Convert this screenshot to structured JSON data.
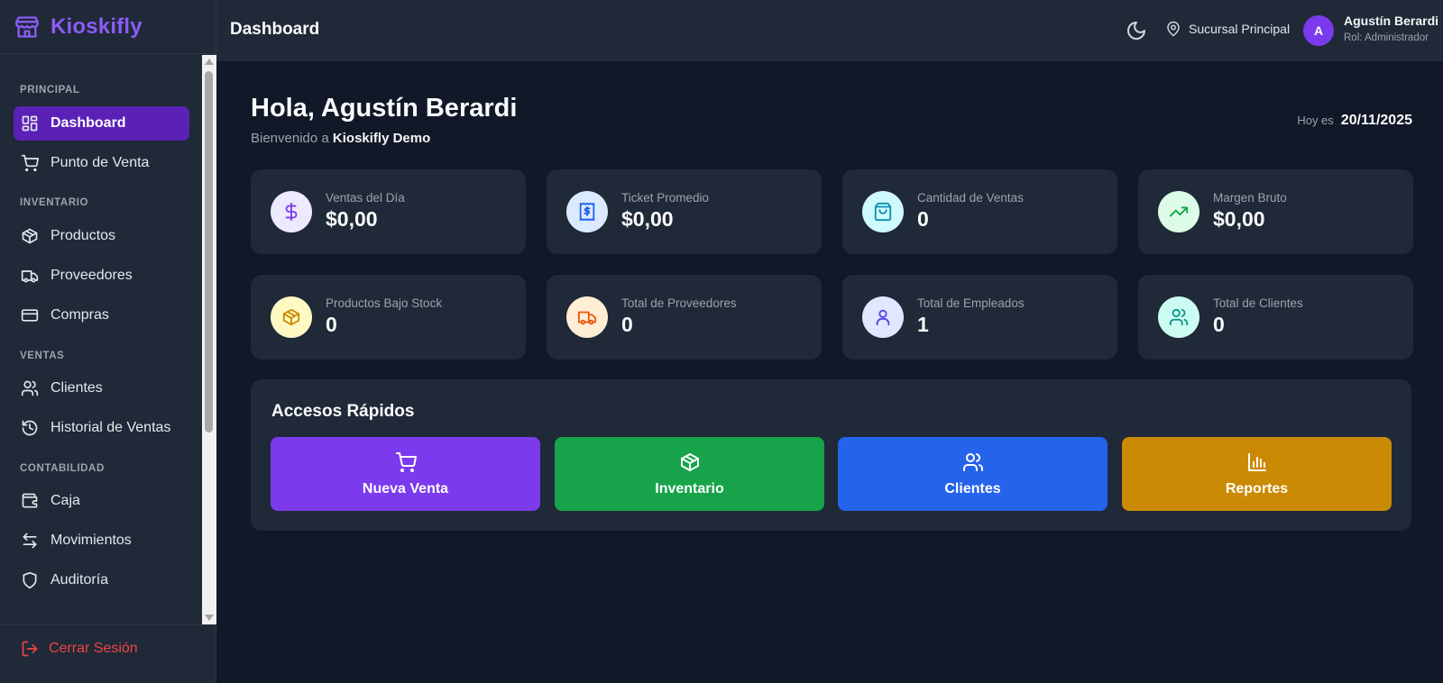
{
  "brand": {
    "name": "Kioskifly",
    "icon": "store-icon"
  },
  "sidebar": {
    "sections": [
      {
        "label": "PRINCIPAL"
      },
      {
        "label": "INVENTARIO"
      },
      {
        "label": "VENTAS"
      },
      {
        "label": "CONTABILIDAD"
      }
    ],
    "items": [
      {
        "label": "Dashboard",
        "icon": "dashboard-icon",
        "active": true
      },
      {
        "label": "Punto de Venta",
        "icon": "cart-icon"
      },
      {
        "label": "Productos",
        "icon": "package-icon"
      },
      {
        "label": "Proveedores",
        "icon": "truck-icon"
      },
      {
        "label": "Compras",
        "icon": "credit-card-icon"
      },
      {
        "label": "Clientes",
        "icon": "users-icon"
      },
      {
        "label": "Historial de Ventas",
        "icon": "history-icon"
      },
      {
        "label": "Caja",
        "icon": "wallet-icon"
      },
      {
        "label": "Movimientos",
        "icon": "arrows-left-right-icon"
      },
      {
        "label": "Auditoría",
        "icon": "shield-icon"
      }
    ],
    "logout": {
      "label": "Cerrar Sesión",
      "icon": "logout-icon",
      "color": "#ef4444"
    }
  },
  "header": {
    "title": "Dashboard",
    "theme_icon": "moon-icon",
    "branch": "Sucursal Principal",
    "user": {
      "initial": "A",
      "name": "Agustín Berardi",
      "role": "Rol: Administrador"
    }
  },
  "main": {
    "greeting": "Hola, Agustín Berardi",
    "welcome_prefix": "Bienvenido a",
    "welcome_store": "Kioskifly Demo",
    "today_label": "Hoy es",
    "today_date": "20/11/2025",
    "stats": [
      {
        "label": "Ventas del Día",
        "value": "$0,00",
        "icon": "dollar-icon",
        "color": "#7c3aed",
        "bg": "#ede9fe"
      },
      {
        "label": "Ticket Promedio",
        "value": "$0,00",
        "icon": "receipt-icon",
        "color": "#2563eb",
        "bg": "#dbeafe"
      },
      {
        "label": "Cantidad de Ventas",
        "value": "0",
        "icon": "shopping-bag-icon",
        "color": "#0891b2",
        "bg": "#cffafe"
      },
      {
        "label": "Margen Bruto",
        "value": "$0,00",
        "icon": "trending-up-icon",
        "color": "#16a34a",
        "bg": "#dcfce7"
      },
      {
        "label": "Productos Bajo Stock",
        "value": "0",
        "icon": "package-icon",
        "color": "#ca8a04",
        "bg": "#fef9c3"
      },
      {
        "label": "Total de Proveedores",
        "value": "0",
        "icon": "truck-icon",
        "color": "#ea580c",
        "bg": "#ffedd5"
      },
      {
        "label": "Total de Empleados",
        "value": "1",
        "icon": "user-icon",
        "color": "#4f46e5",
        "bg": "#e0e7ff"
      },
      {
        "label": "Total de Clientes",
        "value": "0",
        "icon": "users-icon",
        "color": "#0d9488",
        "bg": "#ccfbf1"
      }
    ],
    "quick_access": {
      "title": "Accesos Rápidos",
      "buttons": [
        {
          "label": "Nueva Venta",
          "icon": "cart-icon",
          "color": "#7c3aed"
        },
        {
          "label": "Inventario",
          "icon": "package-icon",
          "color": "#16a34a"
        },
        {
          "label": "Clientes",
          "icon": "users-icon",
          "color": "#2563eb"
        },
        {
          "label": "Reportes",
          "icon": "bar-chart-icon",
          "color": "#ca8a04"
        }
      ]
    }
  }
}
